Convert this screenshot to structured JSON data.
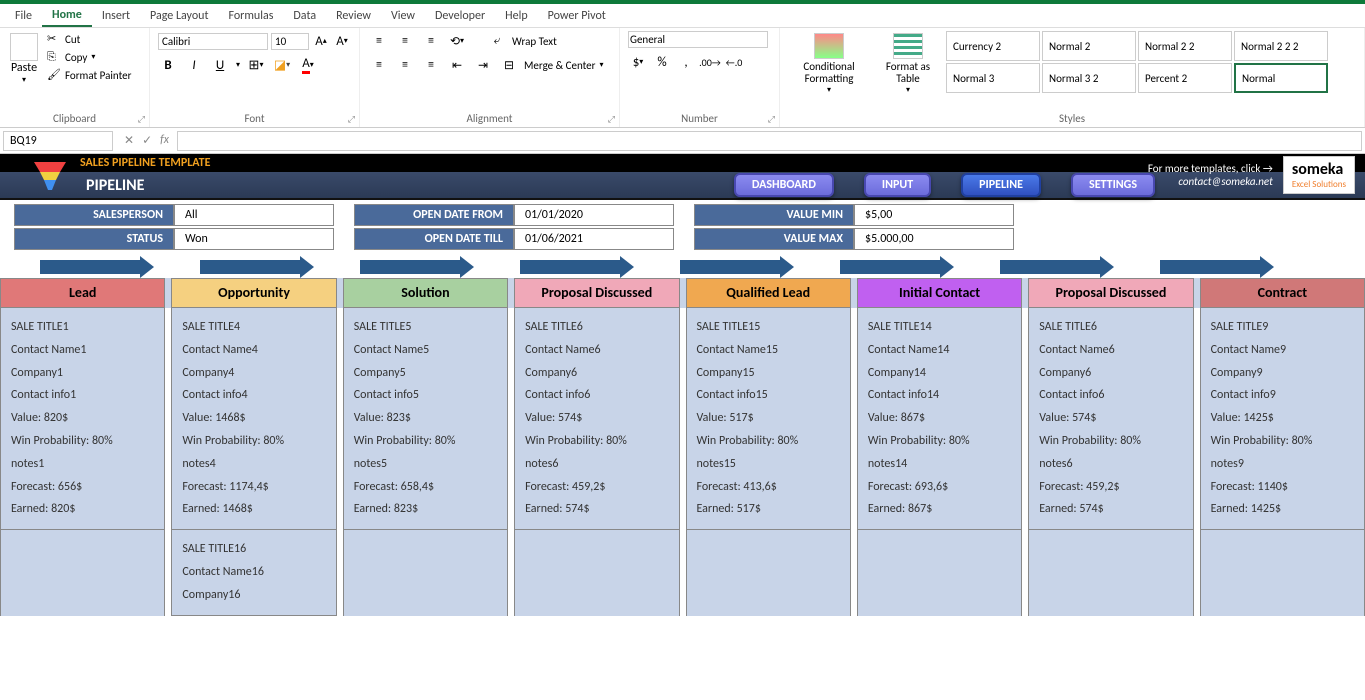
{
  "menu": [
    "File",
    "Home",
    "Insert",
    "Page Layout",
    "Formulas",
    "Data",
    "Review",
    "View",
    "Developer",
    "Help",
    "Power Pivot"
  ],
  "menu_active": 1,
  "ribbon": {
    "clipboard": {
      "paste": "Paste",
      "cut": "Cut",
      "copy": "Copy",
      "fmt": "Format Painter",
      "title": "Clipboard"
    },
    "font": {
      "name": "Calibri",
      "size": "10",
      "title": "Font",
      "b": "B",
      "i": "I",
      "u": "U"
    },
    "alignment": {
      "wrap": "Wrap Text",
      "merge": "Merge & Center",
      "title": "Alignment"
    },
    "number": {
      "fmt": "General",
      "title": "Number"
    },
    "styles": {
      "cond": "Conditional Formatting",
      "table": "Format as Table",
      "title": "Styles",
      "cells": [
        "Currency 2",
        "Normal 2",
        "Normal 2 2",
        "Normal 2 2 2",
        "Normal 3",
        "Normal 3 2",
        "Percent 2",
        "Normal"
      ]
    }
  },
  "namebox": "BQ19",
  "template": {
    "title": "SALES PIPELINE TEMPLATE",
    "section": "PIPELINE",
    "nav": [
      "DASHBOARD",
      "INPUT",
      "PIPELINE",
      "SETTINGS"
    ],
    "nav_active": 2,
    "more": "For more templates, click →",
    "contact": "contact@someka.net",
    "brand": "someka",
    "brand_sub": "Excel Solutions"
  },
  "filters": [
    [
      {
        "l": "SALESPERSON",
        "v": "All"
      },
      {
        "l": "STATUS",
        "v": "Won"
      }
    ],
    [
      {
        "l": "OPEN DATE FROM",
        "v": "01/01/2020"
      },
      {
        "l": "OPEN DATE TILL",
        "v": "01/06/2021"
      }
    ],
    [
      {
        "l": "VALUE MIN",
        "v": "$5,00"
      },
      {
        "l": "VALUE MAX",
        "v": "$5.000,00"
      }
    ]
  ],
  "stages": [
    {
      "name": "Lead",
      "color": "#e07878"
    },
    {
      "name": "Opportunity",
      "color": "#f5d080"
    },
    {
      "name": "Solution",
      "color": "#a8d0a0"
    },
    {
      "name": "Proposal Discussed",
      "color": "#f0a8b8"
    },
    {
      "name": "Qualified Lead",
      "color": "#f0a850"
    },
    {
      "name": "Initial Contact",
      "color": "#c060f0"
    },
    {
      "name": "Proposal Discussed",
      "color": "#f0a8b8"
    },
    {
      "name": "Contract",
      "color": "#d07878"
    }
  ],
  "cards": [
    [
      {
        "t": "SALE TITLE1",
        "c": "Contact Name1",
        "co": "Company1",
        "ci": "Contact info1",
        "v": "Value: 820$",
        "w": "Win Probability: 80%",
        "n": "notes1",
        "f": "Forecast: 656$",
        "e": "Earned: 820$"
      }
    ],
    [
      {
        "t": "SALE TITLE4",
        "c": "Contact Name4",
        "co": "Company4",
        "ci": "Contact info4",
        "v": "Value: 1468$",
        "w": "Win Probability: 80%",
        "n": "notes4",
        "f": "Forecast: 1174,4$",
        "e": "Earned: 1468$"
      },
      {
        "t": "SALE TITLE16",
        "c": "Contact Name16",
        "co": "Company16",
        "ci": "",
        "v": "",
        "w": "",
        "n": "",
        "f": "",
        "e": ""
      }
    ],
    [
      {
        "t": "SALE TITLE5",
        "c": "Contact Name5",
        "co": "Company5",
        "ci": "Contact info5",
        "v": "Value: 823$",
        "w": "Win Probability: 80%",
        "n": "notes5",
        "f": "Forecast: 658,4$",
        "e": "Earned: 823$"
      }
    ],
    [
      {
        "t": "SALE TITLE6",
        "c": "Contact Name6",
        "co": "Company6",
        "ci": "Contact info6",
        "v": "Value: 574$",
        "w": "Win Probability: 80%",
        "n": "notes6",
        "f": "Forecast: 459,2$",
        "e": "Earned: 574$"
      }
    ],
    [
      {
        "t": "SALE TITLE15",
        "c": "Contact Name15",
        "co": "Company15",
        "ci": "Contact info15",
        "v": "Value: 517$",
        "w": "Win Probability: 80%",
        "n": "notes15",
        "f": "Forecast: 413,6$",
        "e": "Earned: 517$"
      }
    ],
    [
      {
        "t": "SALE TITLE14",
        "c": "Contact Name14",
        "co": "Company14",
        "ci": "Contact info14",
        "v": "Value: 867$",
        "w": "Win Probability: 80%",
        "n": "notes14",
        "f": "Forecast: 693,6$",
        "e": "Earned: 867$"
      }
    ],
    [
      {
        "t": "SALE TITLE6",
        "c": "Contact Name6",
        "co": "Company6",
        "ci": "Contact info6",
        "v": "Value: 574$",
        "w": "Win Probability: 80%",
        "n": "notes6",
        "f": "Forecast: 459,2$",
        "e": "Earned: 574$"
      }
    ],
    [
      {
        "t": "SALE TITLE9",
        "c": "Contact Name9",
        "co": "Company9",
        "ci": "Contact info9",
        "v": "Value: 1425$",
        "w": "Win Probability: 80%",
        "n": "notes9",
        "f": "Forecast: 1140$",
        "e": "Earned: 1425$"
      }
    ]
  ]
}
